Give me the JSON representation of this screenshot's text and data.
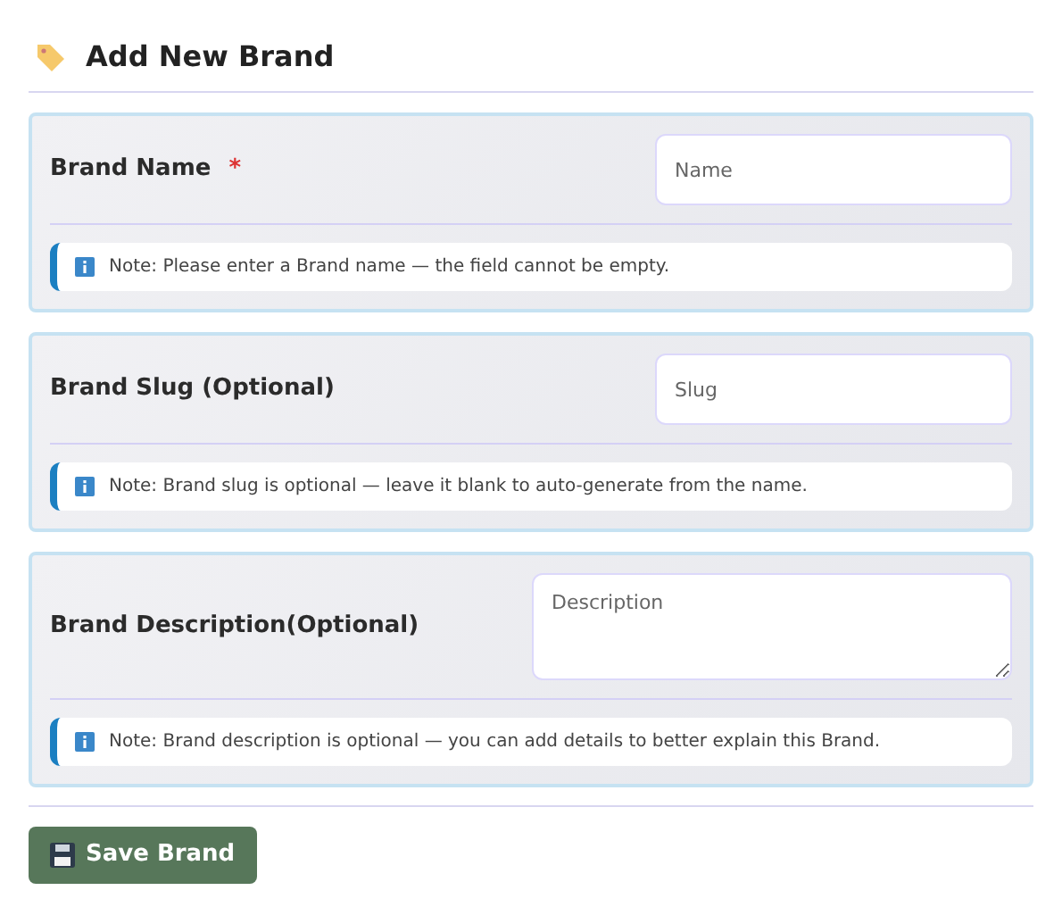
{
  "header": {
    "title": "Add New Brand"
  },
  "fields": [
    {
      "label": "Brand Name",
      "required": true,
      "kind": "input",
      "placeholder": "Name",
      "note": "Note: Please enter a Brand name — the field cannot be empty."
    },
    {
      "label": "Brand Slug (Optional)",
      "required": false,
      "kind": "input",
      "placeholder": "Slug",
      "note": "Note: Brand slug is optional — leave it blank to auto-generate from the name."
    },
    {
      "label": "Brand Description(Optional)",
      "required": false,
      "kind": "textarea",
      "placeholder": "Description",
      "note": "Note: Brand description is optional — you can add details to better explain this Brand."
    }
  ],
  "required_marker": "*",
  "save_button": {
    "label": "Save Brand"
  }
}
